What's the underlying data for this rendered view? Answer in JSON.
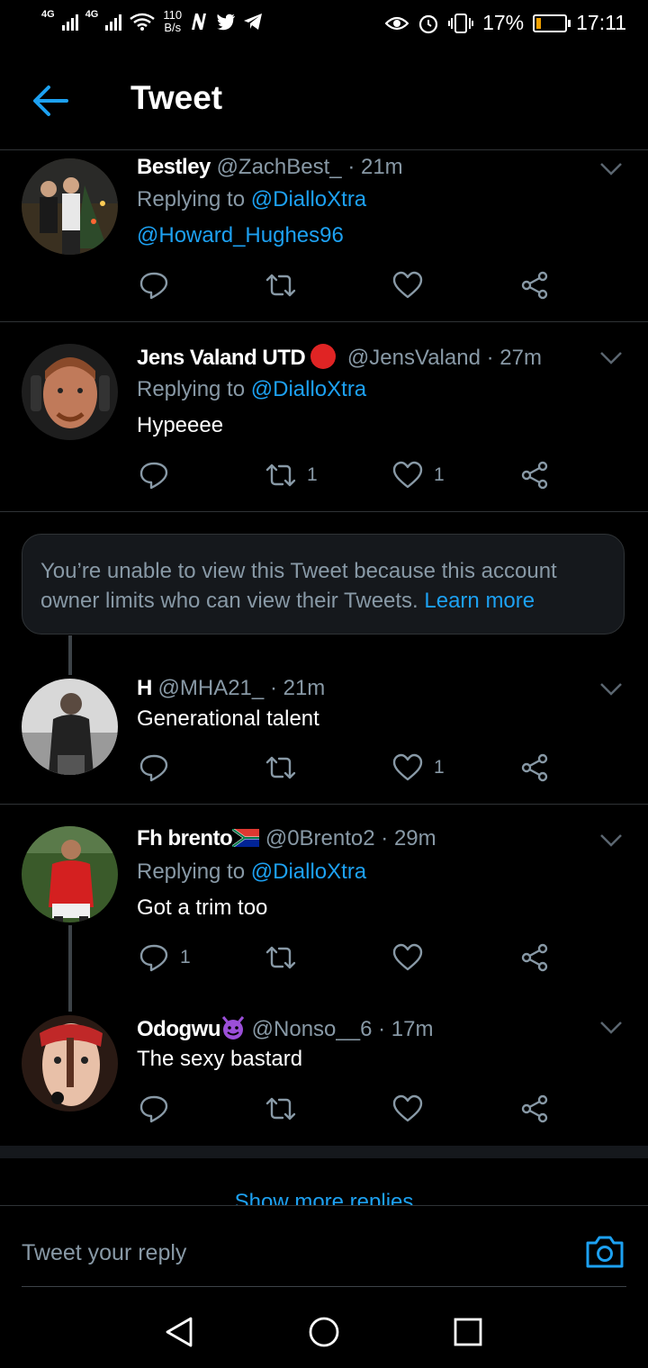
{
  "status_bar": {
    "signal1": "4G",
    "signal2": "4G",
    "net_speed": "110",
    "net_unit": "B/s",
    "battery_percent": "17%",
    "battery_level": 0.17,
    "time": "17:11"
  },
  "header": {
    "title": "Tweet"
  },
  "tweets": [
    {
      "name": "Bestley",
      "handle": "@ZachBest_",
      "time": "· 21m",
      "reply_prefix": "Replying to",
      "reply_to": "@DialloXtra",
      "text": "@Howard_Hughes96",
      "replies": "",
      "retweets": "",
      "likes": ""
    },
    {
      "name": "Jens Valand UTD",
      "handle": "@JensValand",
      "time": "· 27m",
      "reply_prefix": "Replying to",
      "reply_to": "@DialloXtra",
      "text": "Hypeeee",
      "replies": "",
      "retweets": "1",
      "likes": "1"
    },
    {
      "name": "H",
      "handle": "@MHA21_",
      "time": "· 21m",
      "text": "Generational talent",
      "replies": "",
      "retweets": "",
      "likes": "1"
    },
    {
      "name": "Fh brento",
      "handle": "@0Brento2",
      "time": "· 29m",
      "reply_prefix": "Replying to",
      "reply_to": "@DialloXtra",
      "text": "Got a trim too",
      "replies": "1",
      "retweets": "",
      "likes": ""
    },
    {
      "name": "Odogwu",
      "handle": "@Nonso__6",
      "time": "· 17m",
      "text": "The sexy bastard",
      "replies": "",
      "retweets": "",
      "likes": ""
    }
  ],
  "notice": {
    "text": "You’re unable to view this Tweet because this account owner limits who can view their Tweets.",
    "link": "Learn more"
  },
  "show_more": "Show more replies",
  "reply_box": {
    "placeholder": "Tweet your reply"
  },
  "colors": {
    "accent": "#1da1f2",
    "muted": "#8899a6",
    "background": "#000000"
  }
}
